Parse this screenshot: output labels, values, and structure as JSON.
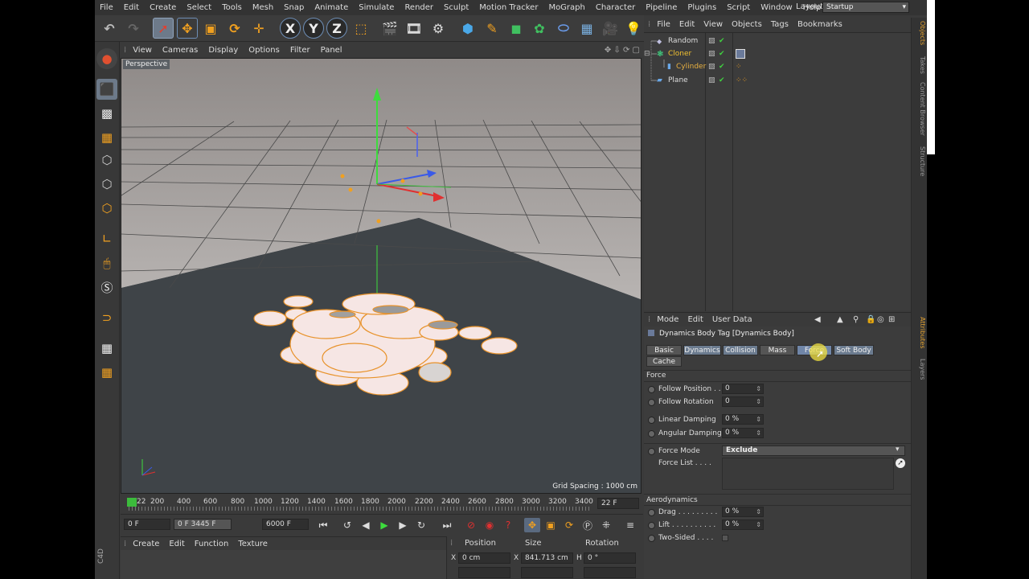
{
  "menubar": {
    "items": [
      "File",
      "Edit",
      "Create",
      "Select",
      "Tools",
      "Mesh",
      "Snap",
      "Animate",
      "Simulate",
      "Render",
      "Sculpt",
      "Motion Tracker",
      "MoGraph",
      "Character",
      "Pipeline",
      "Plugins",
      "Script",
      "Window",
      "Help"
    ],
    "layout_label": "Layout:",
    "layout_value": "Startup"
  },
  "toolbar": {
    "buttons": [
      "undo-icon",
      "redo-icon",
      "live-selection-icon",
      "move-icon",
      "scale-icon",
      "rotate-icon",
      "last-tool-icon",
      "x-axis-icon",
      "y-axis-icon",
      "z-axis-icon",
      "world-coords-icon",
      "render-view-icon",
      "render-picture-viewer-icon",
      "render-settings-icon",
      "cube-icon",
      "pen-icon",
      "subdivision-icon",
      "array-icon",
      "deformer-icon",
      "environment-icon",
      "camera-icon",
      "light-icon"
    ]
  },
  "viewport": {
    "menu": [
      "View",
      "Cameras",
      "Display",
      "Options",
      "Filter",
      "Panel"
    ],
    "label": "Perspective",
    "grid_spacing": "Grid Spacing : 1000 cm"
  },
  "timeline": {
    "ticks": [
      "22",
      "200",
      "400",
      "600",
      "800",
      "1000",
      "1200",
      "1400",
      "1600",
      "1800",
      "2000",
      "2200",
      "2400",
      "2600",
      "2800",
      "3000",
      "3200",
      "3400"
    ],
    "current_frame": "22 F",
    "start_field": "0 F",
    "range_field": "0 F  3445 F",
    "end_field": "6000 F"
  },
  "material_manager": {
    "menu": [
      "Create",
      "Edit",
      "Function",
      "Texture"
    ]
  },
  "coordinates": {
    "headers": [
      "Position",
      "Size",
      "Rotation"
    ],
    "x_pos": "0 cm",
    "x_size": "841.713 cm",
    "h_rot": "0 °",
    "x_label": "X",
    "x2_label": "X",
    "h_label": "H"
  },
  "object_manager": {
    "menu": [
      "File",
      "Edit",
      "View",
      "Objects",
      "Tags",
      "Bookmarks"
    ],
    "objects": [
      {
        "name": "Random",
        "color": "#dddddd"
      },
      {
        "name": "Cloner",
        "color": "#f0c030"
      },
      {
        "name": "Cylinder",
        "color": "#e8b040"
      },
      {
        "name": "Plane",
        "color": "#dddddd"
      }
    ]
  },
  "side_tabs": {
    "top": [
      "Objects",
      "Takes",
      "Content Browser",
      "Structure"
    ],
    "bottom": [
      "Attributes",
      "Layers"
    ]
  },
  "attribute_manager": {
    "menu": [
      "Mode",
      "Edit",
      "User Data"
    ],
    "title": "Dynamics Body Tag [Dynamics Body]",
    "tabs": [
      "Basic",
      "Dynamics",
      "Collision",
      "Mass",
      "Force",
      "Soft Body",
      "Cache"
    ],
    "force_section": "Force",
    "follow_position_label": "Follow Position . .",
    "follow_position_value": "0",
    "follow_rotation_label": "Follow Rotation",
    "follow_rotation_value": "0",
    "linear_damping_label": "Linear Damping",
    "linear_damping_value": "0 %",
    "angular_damping_label": "Angular Damping",
    "angular_damping_value": "0 %",
    "force_mode_label": "Force Mode",
    "force_mode_value": "Exclude",
    "force_list_label": "Force List . . . .",
    "aero_section": "Aerodynamics",
    "drag_label": "Drag . . . . . . . . .",
    "drag_value": "0 %",
    "lift_label": "Lift . . . . . . . . . .",
    "lift_value": "0 %",
    "two_sided_label": "Two-Sided . . . ."
  },
  "colors": {
    "accent_orange": "#e8922a",
    "selection_blue": "#6d7a8a",
    "highlight_yellow": "#f0e040"
  }
}
